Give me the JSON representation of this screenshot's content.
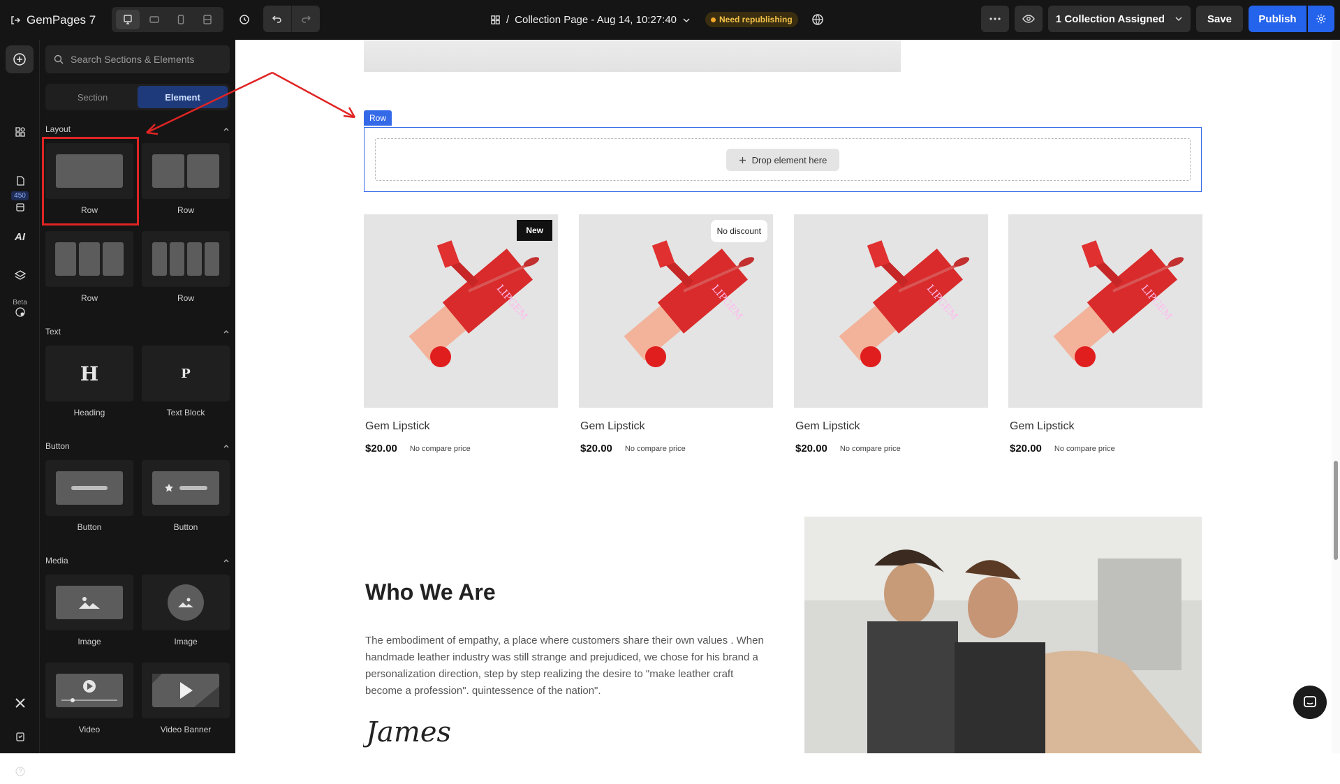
{
  "app": {
    "name": "GemPages 7"
  },
  "header": {
    "page_title": "Collection Page - Aug 14, 10:27:40",
    "breadcrumb_sep": "/",
    "status_badge": "Need republishing",
    "assigned_label": "1 Collection Assigned",
    "save_label": "Save",
    "publish_label": "Publish"
  },
  "rail": {
    "badge": "450",
    "beta": "Beta",
    "ai": "AI"
  },
  "panel": {
    "search_placeholder": "Search Sections & Elements",
    "tabs": [
      "Section",
      "Element"
    ],
    "sections": {
      "layout": "Layout",
      "text": "Text",
      "button": "Button",
      "media": "Media"
    },
    "layout_items": [
      "Row",
      "Row",
      "Row",
      "Row"
    ],
    "text_items": [
      "Heading",
      "Text Block"
    ],
    "button_items": [
      "Button",
      "Button"
    ],
    "media_items": [
      "Image",
      "Image",
      "Video",
      "Video Banner"
    ],
    "heading_glyph": "H",
    "text_glyph": "P"
  },
  "canvas": {
    "row_tag": "Row",
    "drop_label": "Drop element here",
    "products": [
      {
        "name": "Gem Lipstick",
        "price": "$20.00",
        "compare": "No compare price",
        "tag": "New"
      },
      {
        "name": "Gem Lipstick",
        "price": "$20.00",
        "compare": "No compare price",
        "tag": "No discount"
      },
      {
        "name": "Gem Lipstick",
        "price": "$20.00",
        "compare": "No compare price",
        "tag": ""
      },
      {
        "name": "Gem Lipstick",
        "price": "$20.00",
        "compare": "No compare price",
        "tag": ""
      }
    ],
    "who_title": "Who We Are",
    "who_text": "The embodiment of empathy, a place where customers share their own values . When handmade leather industry was still strange and prejudiced, we chose for his brand a personalization direction, step by step realizing the desire to \"make leather craft become a profession\". quintessence of the nation\".",
    "signature": "James",
    "product_brand": "LIPGEM"
  },
  "colors": {
    "accent": "#2463eb",
    "highlight": "#e02424",
    "warn": "#f3c24a"
  }
}
